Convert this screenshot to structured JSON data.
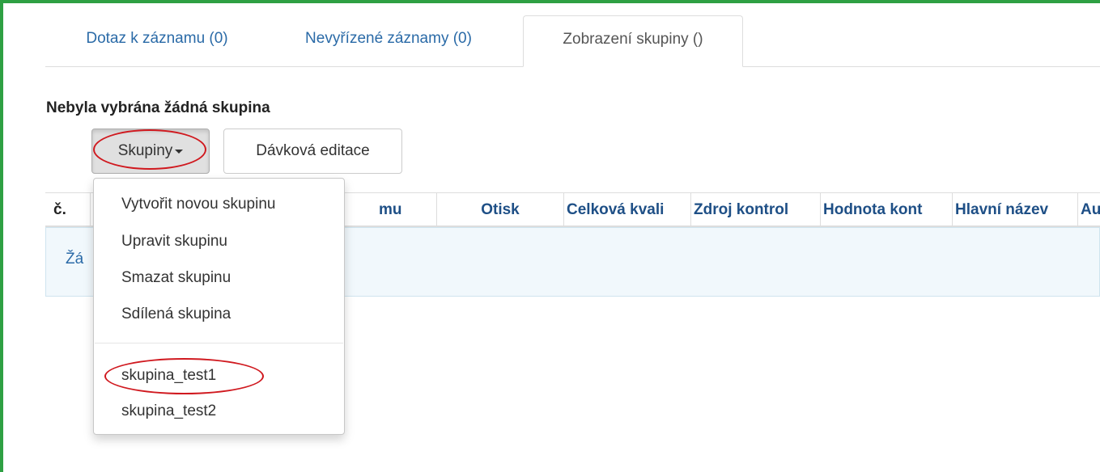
{
  "tabs": [
    {
      "label": "Dotaz k záznamu (0)"
    },
    {
      "label": "Nevyřízené záznamy (0)"
    },
    {
      "label": "Zobrazení skupiny ()"
    }
  ],
  "selection_status": "Nebyla vybrána žádná skupina",
  "toolbar": {
    "groups_label": "Skupiny",
    "batch_edit_label": "Dávková editace"
  },
  "table": {
    "columns": [
      "č.",
      "mu",
      "Otisk",
      "Celková kvali",
      "Zdroj kontrol",
      "Hodnota kont",
      "Hlavní název",
      "Autor ("
    ],
    "empty_text": "Žá"
  },
  "groups_menu": {
    "actions": [
      "Vytvořit novou skupinu",
      "Upravit skupinu",
      "Smazat skupinu",
      "Sdílená skupina"
    ],
    "groups": [
      "skupina_test1",
      "skupina_test2"
    ]
  },
  "colors": {
    "frame": "#2ea043",
    "highlight": "#d0191f",
    "link": "#2a6aa7"
  }
}
